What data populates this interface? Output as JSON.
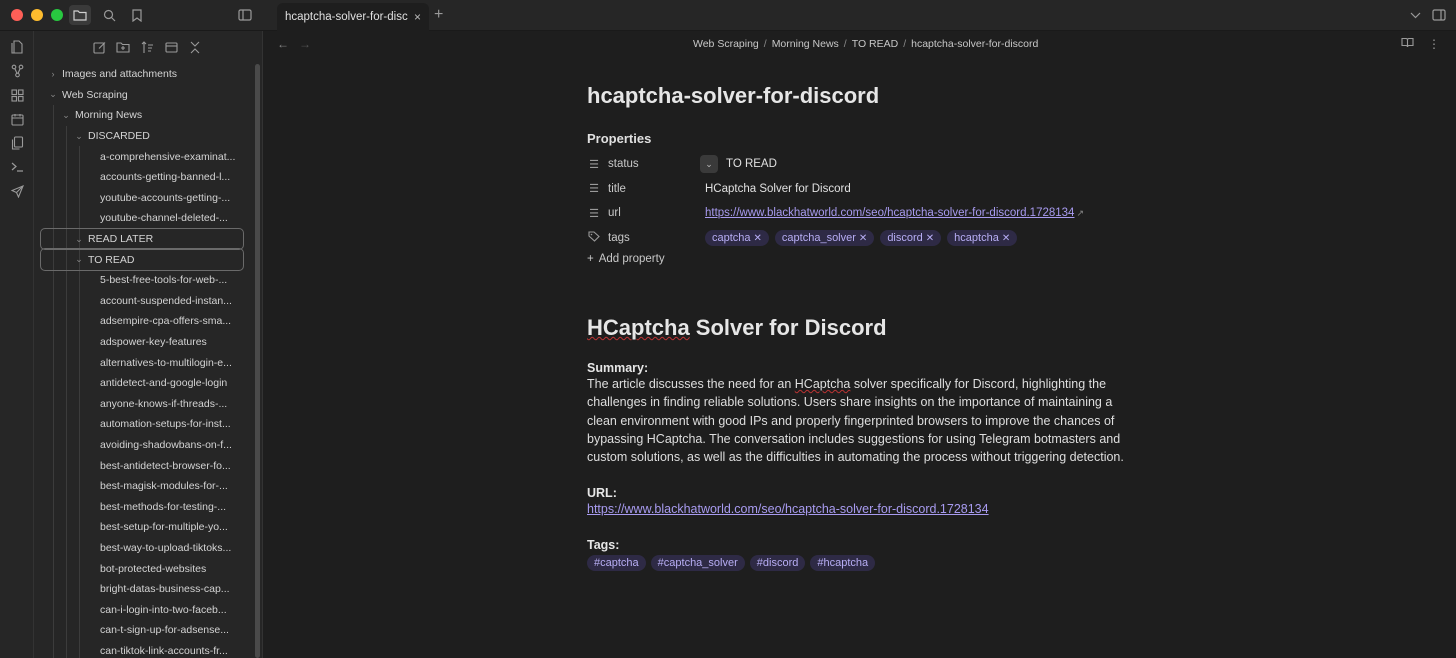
{
  "window": {
    "lights": [
      "#fe5f57",
      "#febc2e",
      "#28c840"
    ]
  },
  "tab": {
    "label": "hcaptcha-solver-for-disc",
    "close": "×"
  },
  "new_tab": "+",
  "breadcrumb": [
    "Web Scraping",
    "Morning News",
    "TO READ",
    "hcaptcha-solver-for-discord"
  ],
  "breadcrumb_sep": "/",
  "sidebar": {
    "tree": [
      {
        "label": "Images and attachments",
        "chev": "›",
        "level": 0
      },
      {
        "label": "Web Scraping",
        "chev": "⌄",
        "level": 0
      },
      {
        "label": "Morning News",
        "chev": "⌄",
        "level": 1
      },
      {
        "label": "DISCARDED",
        "chev": "⌄",
        "level": 2
      },
      {
        "label": "a-comprehensive-examinat...",
        "chev": "",
        "level": 3
      },
      {
        "label": "accounts-getting-banned-l...",
        "chev": "",
        "level": 3
      },
      {
        "label": "youtube-accounts-getting-...",
        "chev": "",
        "level": 3
      },
      {
        "label": "youtube-channel-deleted-...",
        "chev": "",
        "level": 3
      },
      {
        "label": "READ LATER",
        "chev": "⌄",
        "level": 2,
        "boxed": true
      },
      {
        "label": "TO READ",
        "chev": "⌄",
        "level": 2,
        "boxed": true
      },
      {
        "label": "5-best-free-tools-for-web-...",
        "chev": "",
        "level": 3
      },
      {
        "label": "account-suspended-instan...",
        "chev": "",
        "level": 3
      },
      {
        "label": "adsempire-cpa-offers-sma...",
        "chev": "",
        "level": 3
      },
      {
        "label": "adspower-key-features",
        "chev": "",
        "level": 3
      },
      {
        "label": "alternatives-to-multilogin-e...",
        "chev": "",
        "level": 3
      },
      {
        "label": "antidetect-and-google-login",
        "chev": "",
        "level": 3
      },
      {
        "label": "anyone-knows-if-threads-...",
        "chev": "",
        "level": 3
      },
      {
        "label": "automation-setups-for-inst...",
        "chev": "",
        "level": 3
      },
      {
        "label": "avoiding-shadowbans-on-f...",
        "chev": "",
        "level": 3
      },
      {
        "label": "best-antidetect-browser-fo...",
        "chev": "",
        "level": 3
      },
      {
        "label": "best-magisk-modules-for-...",
        "chev": "",
        "level": 3
      },
      {
        "label": "best-methods-for-testing-...",
        "chev": "",
        "level": 3
      },
      {
        "label": "best-setup-for-multiple-yo...",
        "chev": "",
        "level": 3
      },
      {
        "label": "best-way-to-upload-tiktoks...",
        "chev": "",
        "level": 3
      },
      {
        "label": "bot-protected-websites",
        "chev": "",
        "level": 3
      },
      {
        "label": "bright-datas-business-cap...",
        "chev": "",
        "level": 3
      },
      {
        "label": "can-i-login-into-two-faceb...",
        "chev": "",
        "level": 3
      },
      {
        "label": "can-t-sign-up-for-adsense...",
        "chev": "",
        "level": 3
      },
      {
        "label": "can-tiktok-link-accounts-fr...",
        "chev": "",
        "level": 3
      }
    ]
  },
  "note": {
    "title": "hcaptcha-solver-for-discord",
    "properties_heading": "Properties",
    "properties": {
      "status": {
        "key": "status",
        "value": "TO READ"
      },
      "title": {
        "key": "title",
        "value": "HCaptcha Solver for Discord"
      },
      "url": {
        "key": "url",
        "value": "https://www.blackhatworld.com/seo/hcaptcha-solver-for-discord.1728134"
      },
      "tags": {
        "key": "tags",
        "values": [
          "captcha",
          "captcha_solver",
          "discord",
          "hcaptcha"
        ]
      }
    },
    "add_property": "Add property",
    "heading_pre": "",
    "heading_sq": "HCaptcha",
    "heading_post": " Solver for Discord",
    "summary_label": "Summary:",
    "summary_p1": "The article discusses the need for an ",
    "summary_sq": "HCaptcha",
    "summary_p2": " solver specifically for Discord, highlighting the challenges in finding reliable solutions. Users share insights on the importance of maintaining a clean environment with good IPs and properly fingerprinted browsers to improve the chances of bypassing HCaptcha. The conversation includes suggestions for using Telegram botmasters and custom solutions, as well as the difficulties in automating the process without triggering detection.",
    "url_label": "URL:",
    "url_value": "https://www.blackhatworld.com/seo/hcaptcha-solver-for-discord.1728134",
    "tags_label": "Tags:",
    "hashtags": [
      "#captcha",
      "#captcha_solver",
      "#discord",
      "#hcaptcha"
    ]
  }
}
